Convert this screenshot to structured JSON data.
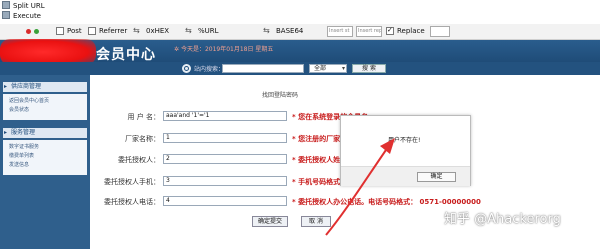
{
  "menu": {
    "items": [
      "Split URL",
      "Execute"
    ]
  },
  "toolbar": {
    "post_label": "Post",
    "referrer_label": "Referrer",
    "hex_label": "0xHEX",
    "url_label": "%URL",
    "base64_label": "BASE64",
    "insert_placeholder_1": "Insert st",
    "insert_placeholder_2": "Insert rep",
    "replace_label": "Replace",
    "replace_checked": true,
    "dot_colors": [
      "#d92b2b",
      "#3aa23a"
    ]
  },
  "header": {
    "title": "会员中心",
    "date": "今天是：2019年01月18日 星期五",
    "search_label": "站内搜索：",
    "search_select": "全部",
    "search_button": "搜 索"
  },
  "sidebar": {
    "sections": [
      {
        "title": "供应商管理",
        "items": [
          "返回会员中心首页",
          "会员状态"
        ]
      },
      {
        "title": "服务管理",
        "items": [
          "数字证书服务",
          "缴费单列表",
          "发送信息"
        ]
      }
    ]
  },
  "form": {
    "title": "找回登陆密码",
    "fields": [
      {
        "label": "用 户 名：",
        "value": "aaa'and    '1'='1",
        "hint": "* 您在系统登录的会员名"
      },
      {
        "label": "厂家名称：",
        "value": "1",
        "hint": "* 您注册的厂家名称。"
      },
      {
        "label": "委托授权人：",
        "value": "2",
        "hint": "* 委托授权人姓名。"
      },
      {
        "label": "委托授权人手机：",
        "value": "3",
        "hint": "* 手机号码格式：1380"
      },
      {
        "label": "委托授权人电话：",
        "value": "4",
        "hint": "* 委托授权人办公电话。电话号码格式： 0571-00000000"
      }
    ],
    "submit_button": "确定提交",
    "cancel_button": "取 消"
  },
  "dialog": {
    "message": "用户不存在!",
    "ok_button": "确定"
  },
  "colors": {
    "header_blue": "#23527f",
    "hint_red": "#c81c1c",
    "arrow_red": "#e03030"
  },
  "watermark": "知乎 @Ahackerorg"
}
